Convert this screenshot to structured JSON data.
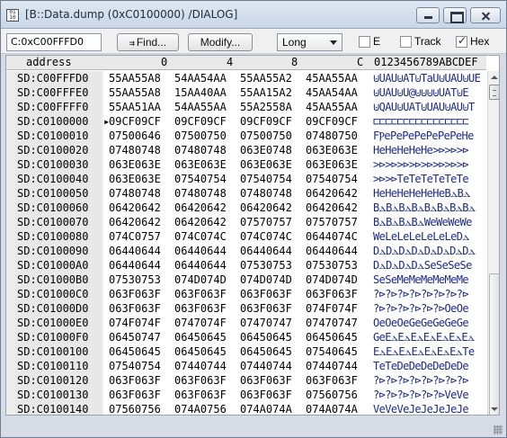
{
  "window": {
    "title": "[B::Data.dump (0xC0100000) /DIALOG]",
    "app_icon_text": "01 10 01"
  },
  "toolbar": {
    "address_value": "C:0xC00FFFD0",
    "find_icon": "find-icon",
    "find_label": "Find...",
    "modify_label": "Modify...",
    "format_value": "Long",
    "e_label": "E",
    "e_checked": false,
    "track_label": "Track",
    "track_checked": false,
    "hex_label": "Hex",
    "hex_checked": true
  },
  "grid": {
    "header": {
      "address": "address",
      "c0": "0",
      "c4": "4",
      "c8": "8",
      "cC": "C",
      "ascii": "0123456789ABCDEF"
    },
    "current_marker": "▸",
    "rows": [
      {
        "addr": "SD:C00FFFD0",
        "w": [
          "55AA55A8",
          "54AA54AA",
          "55AA55A2",
          "45AA55AA"
        ],
        "ascii": "⊍UAU⊍AT⊍TaU⊍UAU⊍UE"
      },
      {
        "addr": "SD:C00FFFE0",
        "w": [
          "55AA55A8",
          "15AA40AA",
          "55AA15A2",
          "45AA54AA"
        ],
        "ascii": "⊍UAU⊍U@⊍⊍⊍⊍UAT⊍E"
      },
      {
        "addr": "SD:C00FFFF0",
        "w": [
          "55AA51AA",
          "54AA55AA",
          "55A2558A",
          "45AA55AA"
        ],
        "ascii": "⊍QAU⊍UAT⊍UAU⊍AU⊍T"
      },
      {
        "addr": "SD:C0100000",
        "current": true,
        "w": [
          "09CF09CF",
          "09CF09CF",
          "09CF09CF",
          "09CF09CF"
        ],
        "ascii": "⊏⊏⊏⊏⊏⊏⊏⊏⊏⊏⊏⊏⊏⊏⊏⊏"
      },
      {
        "addr": "SD:C0100010",
        "w": [
          "07500646",
          "07500750",
          "07500750",
          "07480750"
        ],
        "ascii": "FⲢePePePePePePeHe"
      },
      {
        "addr": "SD:C0100020",
        "w": [
          "07480748",
          "07480748",
          "063E0748",
          "063E063E"
        ],
        "ascii": "HeHeHeHeHe>⊳>⊳>⊳"
      },
      {
        "addr": "SD:C0100030",
        "w": [
          "063E063E",
          "063E063E",
          "063E063E",
          "063E063E"
        ],
        "ascii": ">⊳>⊳>⊳>⊳>⊳>⊳>⊳>⊳"
      },
      {
        "addr": "SD:C0100040",
        "w": [
          "063E063E",
          "07540754",
          "07540754",
          "07540754"
        ],
        "ascii": ">⊳>⊳TeTeTeTeTeTe"
      },
      {
        "addr": "SD:C0100050",
        "w": [
          "07480748",
          "07480748",
          "07480748",
          "06420642"
        ],
        "ascii": "HeHeHeHeHeHeBⲇBⲇ"
      },
      {
        "addr": "SD:C0100060",
        "w": [
          "06420642",
          "06420642",
          "06420642",
          "06420642"
        ],
        "ascii": "BⲇBⲇBⲇBⲇBⲇBⲇBⲇBⲇ"
      },
      {
        "addr": "SD:C0100070",
        "w": [
          "06420642",
          "06420642",
          "07570757",
          "07570757"
        ],
        "ascii": "BⲇBⲇBⲇBⲇWeWeWeWe"
      },
      {
        "addr": "SD:C0100080",
        "w": [
          "074C0757",
          "074C074C",
          "074C074C",
          "0644074C"
        ],
        "ascii": "WeLeLeLeLeLeLeDⲇ"
      },
      {
        "addr": "SD:C0100090",
        "w": [
          "06440644",
          "06440644",
          "06440644",
          "06440644"
        ],
        "ascii": "DⲇDⲇDⲇDⲇDⲇDⲇDⲇDⲇ"
      },
      {
        "addr": "SD:C01000A0",
        "w": [
          "06440644",
          "06440644",
          "07530753",
          "07530753"
        ],
        "ascii": "DⲇDⲇDⲇDⲇSeSeSeSe"
      },
      {
        "addr": "SD:C01000B0",
        "w": [
          "07530753",
          "074D074D",
          "074D074D",
          "074D074D"
        ],
        "ascii": "SeSeMeMeMeMeMeMe"
      },
      {
        "addr": "SD:C01000C0",
        "w": [
          "063F063F",
          "063F063F",
          "063F063F",
          "063F063F"
        ],
        "ascii": "?⊳?⊳?⊳?⊳?⊳?⊳?⊳?⊳"
      },
      {
        "addr": "SD:C01000D0",
        "w": [
          "063F063F",
          "063F063F",
          "063F063F",
          "074F074F"
        ],
        "ascii": "?⊳?⊳?⊳?⊳?⊳?⊳OeOe"
      },
      {
        "addr": "SD:C01000E0",
        "w": [
          "074F074F",
          "0747074F",
          "07470747",
          "07470747"
        ],
        "ascii": "OeOeOeGeGeGeGeGe"
      },
      {
        "addr": "SD:C01000F0",
        "w": [
          "06450747",
          "06450645",
          "06450645",
          "06450645"
        ],
        "ascii": "GeEⲇEⲇEⲇEⲇEⲇEⲇEⲇ"
      },
      {
        "addr": "SD:C0100100",
        "w": [
          "06450645",
          "06450645",
          "06450645",
          "07540645"
        ],
        "ascii": "EⲇEⲇEⲇEⲇEⲇEⲇEⲇTe"
      },
      {
        "addr": "SD:C0100110",
        "w": [
          "07540754",
          "07440744",
          "07440744",
          "07440744"
        ],
        "ascii": "TeTeDeDeDeDeDeDe"
      },
      {
        "addr": "SD:C0100120",
        "w": [
          "063F063F",
          "063F063F",
          "063F063F",
          "063F063F"
        ],
        "ascii": "?⊳?⊳?⊳?⊳?⊳?⊳?⊳?⊳"
      },
      {
        "addr": "SD:C0100130",
        "w": [
          "063F063F",
          "063F063F",
          "063F063F",
          "07560756"
        ],
        "ascii": "?⊳?⊳?⊳?⊳?⊳?⊳VeVe"
      },
      {
        "addr": "SD:C0100140",
        "w": [
          "07560756",
          "074A0756",
          "074A074A",
          "074A074A"
        ],
        "ascii": "VeVeVeJeJeJeJeJe"
      }
    ]
  },
  "icons": {
    "scroll_up": "scroll-up-icon",
    "scroll_down": "scroll-down-icon"
  }
}
